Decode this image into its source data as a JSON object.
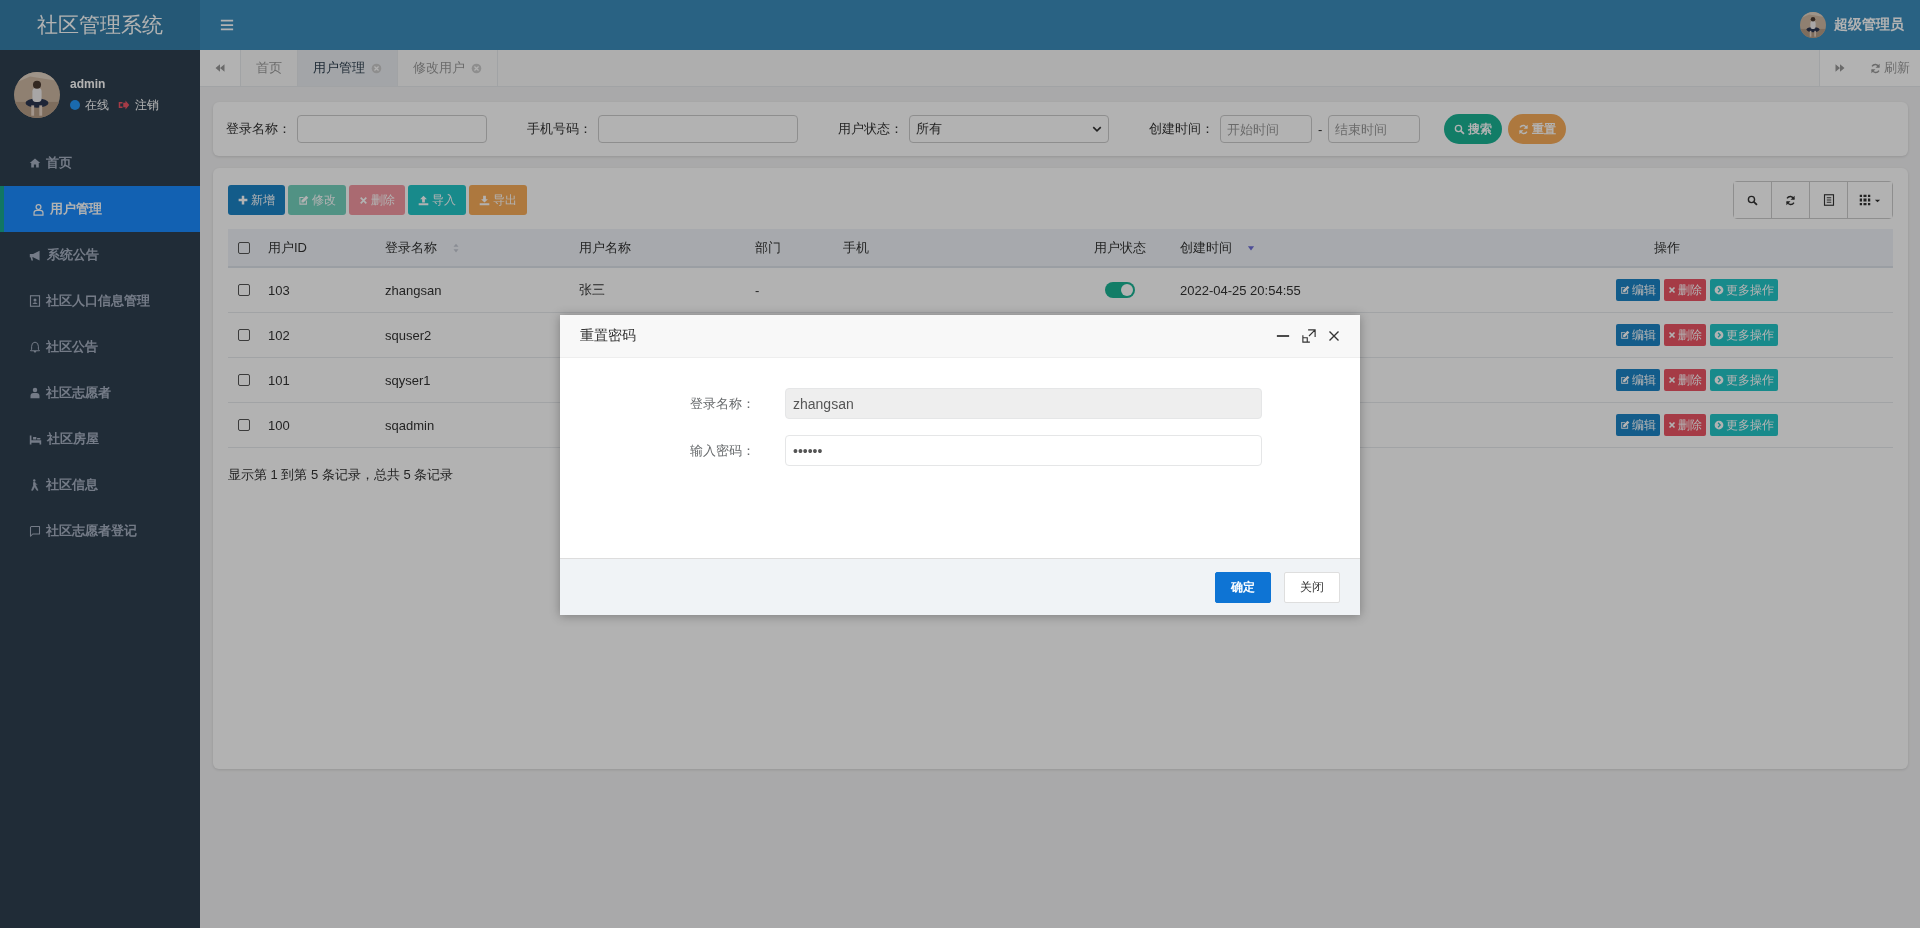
{
  "app": {
    "title": "社区管理系统"
  },
  "user_panel": {
    "name": "admin",
    "status": {
      "label": "在线",
      "color": "#1a6aae"
    },
    "logout": "注销"
  },
  "sidebar": {
    "items": [
      {
        "label": "首页",
        "selected": false
      },
      {
        "label": "用户管理",
        "selected": true
      },
      {
        "label": "系统公告",
        "selected": false
      },
      {
        "label": "社区人口信息管理",
        "selected": false
      },
      {
        "label": "社区公告",
        "selected": false
      },
      {
        "label": "社区志愿者",
        "selected": false
      },
      {
        "label": "社区房屋",
        "selected": false
      },
      {
        "label": "社区信息",
        "selected": false
      },
      {
        "label": "社区志愿者登记",
        "selected": false
      }
    ]
  },
  "topbar": {
    "user": "超级管理员"
  },
  "tabs": [
    {
      "label": "首页",
      "selected": false,
      "closable": false
    },
    {
      "label": "用户管理",
      "selected": true,
      "closable": true
    },
    {
      "label": "修改用户",
      "selected": false,
      "closable": true
    }
  ],
  "refresh": "刷新",
  "search_form": {
    "login_name": {
      "label": "登录名称："
    },
    "phone": {
      "label": "手机号码："
    },
    "status": {
      "label": "用户状态：",
      "value": "所有"
    },
    "created": {
      "label": "创建时间：",
      "start_placeholder": "开始时间",
      "separator": "-",
      "end_placeholder": "结束时间"
    },
    "buttons": [
      {
        "label": "搜索",
        "kind": "success"
      },
      {
        "label": "重置",
        "kind": "warning"
      }
    ]
  },
  "toolbar": [
    {
      "label": "新增",
      "kind": "primary",
      "disabled": false
    },
    {
      "label": "修改",
      "kind": "success",
      "disabled": true
    },
    {
      "label": "删除",
      "kind": "danger",
      "disabled": true
    },
    {
      "label": "导入",
      "kind": "info",
      "disabled": false
    },
    {
      "label": "导出",
      "kind": "warning",
      "disabled": false
    }
  ],
  "table": {
    "select_all": {
      "checked": false
    },
    "columns": [
      {
        "label": "用户ID"
      },
      {
        "label": "登录名称",
        "sortable": true,
        "sort_descending": false
      },
      {
        "label": "用户名称"
      },
      {
        "label": "部门"
      },
      {
        "label": "手机"
      },
      {
        "label": "用户状态"
      },
      {
        "label": "创建时间",
        "sortable": true,
        "sort_descending": true
      },
      {
        "label": "操作"
      }
    ],
    "rows": [
      {
        "checked": false,
        "id": "103",
        "login_name": "zhangsan",
        "user_name": "张三",
        "dept": "-",
        "on": true,
        "created": "2022-04-25 20:54:55",
        "actions": [
          "编辑",
          "删除",
          "更多操作"
        ]
      },
      {
        "checked": false,
        "id": "102",
        "login_name": "squser2",
        "actions": [
          "编辑",
          "删除",
          "更多操作"
        ]
      },
      {
        "checked": false,
        "id": "101",
        "login_name": "sqyser1",
        "actions": [
          "编辑",
          "删除",
          "更多操作"
        ]
      },
      {
        "checked": false,
        "id": "100",
        "login_name": "sqadmin",
        "actions": [
          "编辑",
          "删除",
          "更多操作"
        ]
      }
    ]
  },
  "pagination": {
    "info": "显示第 1 到第 5 条记录，总共 5 条记录"
  },
  "dialog": {
    "title": "重置密码",
    "fields": [
      {
        "label": "登录名称：",
        "value": "zhangsan",
        "readonly": true
      },
      {
        "label": "输入密码：",
        "value": "••••••",
        "readonly": false
      }
    ],
    "buttons": [
      {
        "label": "确定",
        "kind": "primary"
      },
      {
        "label": "关闭",
        "kind": "default"
      }
    ]
  }
}
